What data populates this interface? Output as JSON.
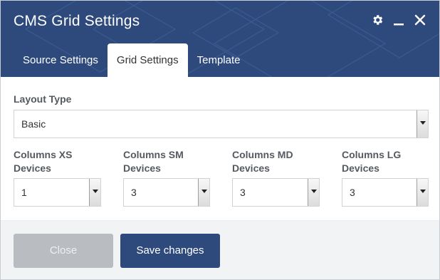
{
  "dialog": {
    "title": "CMS Grid Settings",
    "header_icons": [
      "gear-icon",
      "minimize-icon",
      "close-icon"
    ]
  },
  "tabs": [
    {
      "label": "Source Settings",
      "active": false
    },
    {
      "label": "Grid Settings",
      "active": true
    },
    {
      "label": "Template",
      "active": false
    }
  ],
  "form": {
    "layout_type": {
      "label": "Layout Type",
      "value": "Basic"
    },
    "columns": [
      {
        "label_line1": "Columns XS",
        "label_line2": "Devices",
        "value": "1"
      },
      {
        "label_line1": "Columns SM",
        "label_line2": "Devices",
        "value": "3"
      },
      {
        "label_line1": "Columns MD",
        "label_line2": "Devices",
        "value": "3"
      },
      {
        "label_line1": "Columns LG",
        "label_line2": "Devices",
        "value": "3"
      }
    ]
  },
  "footer": {
    "close_label": "Close",
    "save_label": "Save changes"
  },
  "colors": {
    "header_bg": "#2e4a7d",
    "primary_button": "#2e4a7d",
    "disabled_button": "#b9bcc0",
    "footer_bg": "#f2f3f5"
  }
}
